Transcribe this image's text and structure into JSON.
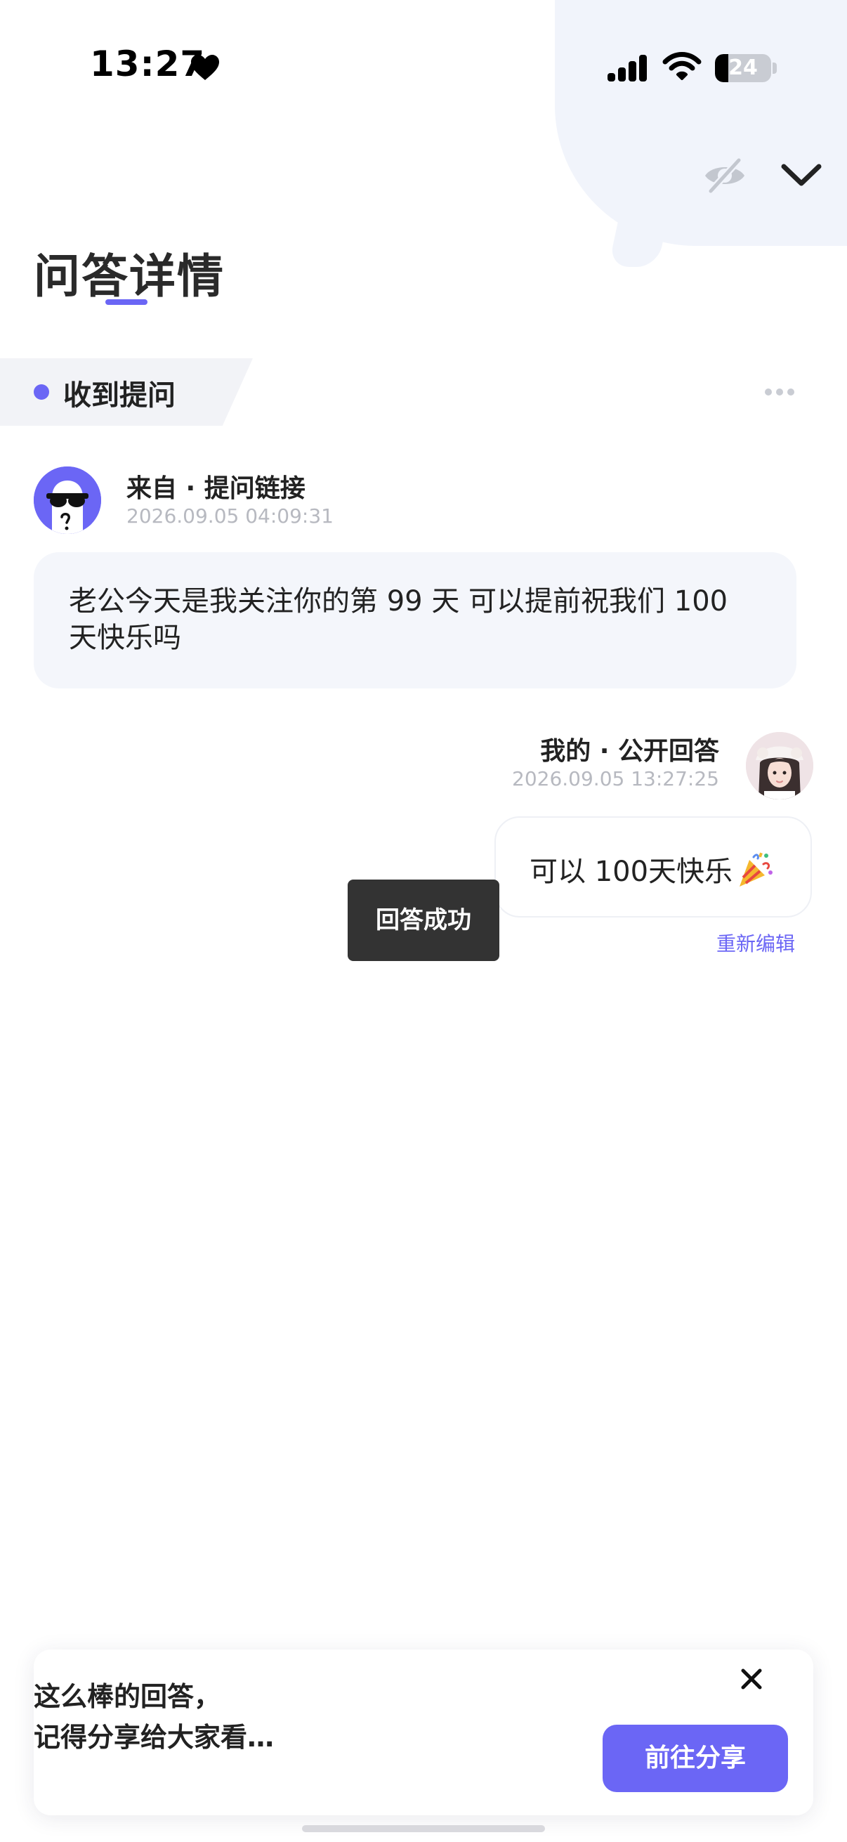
{
  "status_bar": {
    "time": "13:27",
    "battery": "24",
    "icons": [
      "heart-icon",
      "signal-icon",
      "wifi-icon",
      "battery-icon"
    ]
  },
  "header": {
    "title": "问答详情",
    "icons": [
      "eye-off-icon",
      "chevron-down-icon"
    ]
  },
  "section": {
    "label": "收到提问",
    "more_icon": "more-icon"
  },
  "question": {
    "source": "来自 · 提问链接",
    "time": "2026.09.05 04:09:31",
    "text": "老公今天是我关注你的第 99 天 可以提前祝我们 100 天快乐吗"
  },
  "answer": {
    "meta": "我的 · 公开回答",
    "time": "2026.09.05 13:27:25",
    "text": "可以 100天快乐",
    "emoji_icon": "party-popper-icon",
    "edit_label": "重新编辑"
  },
  "toast": {
    "text": "回答成功"
  },
  "share_card": {
    "line1": "这么棒的回答，",
    "line2": "记得分享给大家看…",
    "button_label": "前往分享",
    "close_icon": "close-icon"
  },
  "colors": {
    "accent": "#6b66f5",
    "bubble_bg": "#f4f6fb",
    "muted_text": "#b7b9c0",
    "toast_bg": "#333333"
  }
}
